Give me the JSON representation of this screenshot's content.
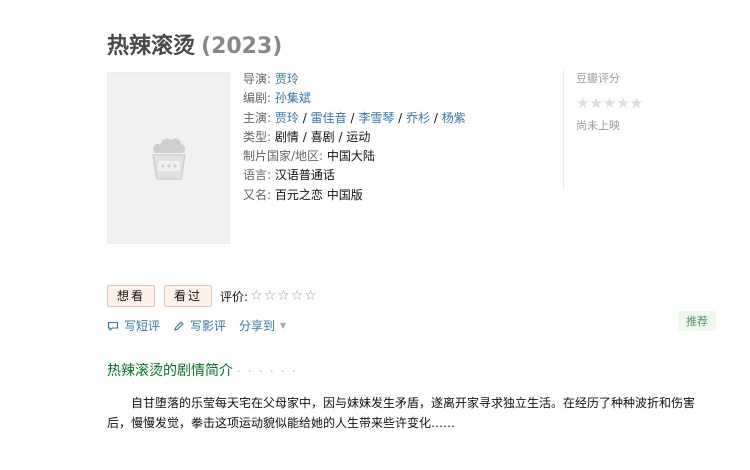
{
  "title": "热辣滚烫",
  "year": "(2023)",
  "info": {
    "director_label": "导演:",
    "directors": [
      "贾玲"
    ],
    "writer_label": "编剧:",
    "writers": [
      "孙集斌"
    ],
    "cast_label": "主演:",
    "cast": [
      "贾玲",
      "雷佳音",
      "李雪琴",
      "乔杉",
      "杨紫"
    ],
    "genre_label": "类型:",
    "genres": [
      "剧情",
      "喜剧",
      "运动"
    ],
    "region_label": "制片国家/地区:",
    "region": "中国大陆",
    "language_label": "语言:",
    "language": "汉语普通话",
    "aka_label": "又名:",
    "aka": "百元之恋 中国版"
  },
  "rating": {
    "label": "豆瓣评分",
    "stars": "★★★★★",
    "status": "尚未上映"
  },
  "actions": {
    "want": "想看",
    "watched": "看过",
    "rate_label": "评价:",
    "rate_stars": "☆☆☆☆☆"
  },
  "tools": {
    "write_review_short": "写短评",
    "write_review": "写影评",
    "share": "分享到",
    "recommend": "推荐"
  },
  "summary": {
    "heading": "热辣滚烫的剧情简介",
    "heading_dots": "· · · · · ·",
    "text": "自甘堕落的乐莹每天宅在父母家中，因与妹妹发生矛盾，遂离开家寻求独立生活。在经历了种种波折和伤害后，慢慢发觉，拳击这项运动貌似能给她的人生带来些许变化……"
  },
  "colors": {
    "link": "#3377aa",
    "section_green": "#007722",
    "want_button_bg": "#fff2e8"
  }
}
